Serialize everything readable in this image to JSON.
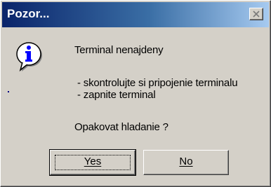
{
  "window": {
    "title": "Pozor...",
    "close_icon": "close-icon"
  },
  "message": {
    "icon": "info-icon",
    "title": "Terminal nenajdeny",
    "line1": "- skontrolujte si pripojenie terminalu",
    "line2": "- zapnite terminal",
    "question": "Opakovat hladanie ?"
  },
  "buttons": {
    "yes_label": "Yes",
    "no_label": "No"
  },
  "colors": {
    "titlebar_start": "#0a246a",
    "titlebar_end": "#a6caf0",
    "face": "#d4d0c8"
  }
}
